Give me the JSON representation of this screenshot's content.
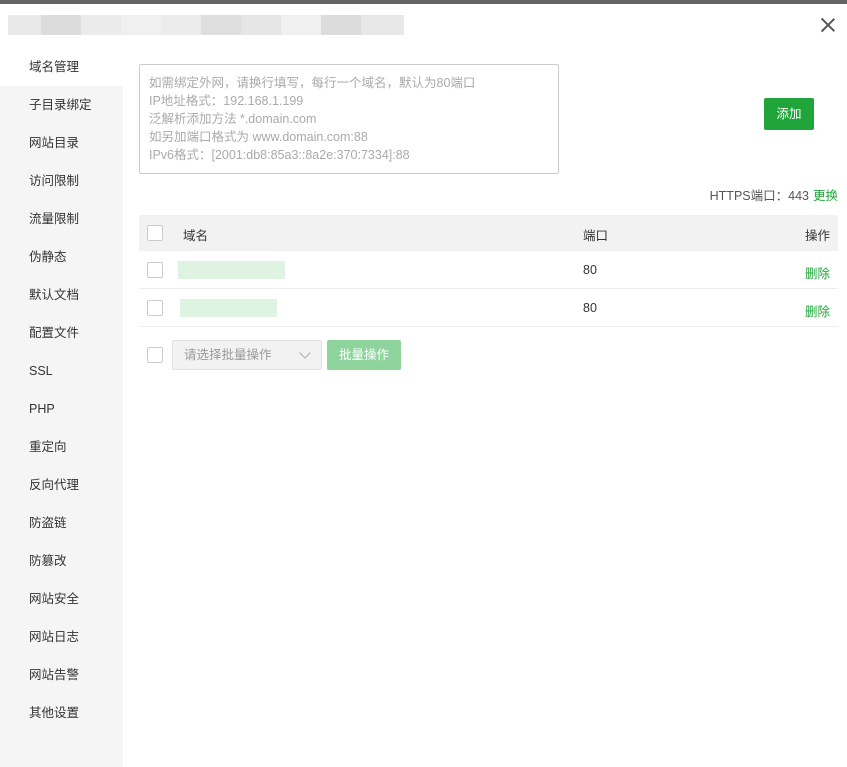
{
  "sidebar": {
    "items": [
      {
        "label": "域名管理"
      },
      {
        "label": "子目录绑定"
      },
      {
        "label": "网站目录"
      },
      {
        "label": "访问限制"
      },
      {
        "label": "流量限制"
      },
      {
        "label": "伪静态"
      },
      {
        "label": "默认文档"
      },
      {
        "label": "配置文件"
      },
      {
        "label": "SSL"
      },
      {
        "label": "PHP"
      },
      {
        "label": "重定向"
      },
      {
        "label": "反向代理"
      },
      {
        "label": "防盗链"
      },
      {
        "label": "防篡改"
      },
      {
        "label": "网站安全"
      },
      {
        "label": "网站日志"
      },
      {
        "label": "网站告警"
      },
      {
        "label": "其他设置"
      }
    ],
    "active_index": 0
  },
  "domain_input": {
    "value": "",
    "placeholder_lines": [
      "如需绑定外网，请换行填写，每行一个域名，默认为80端口",
      "IP地址格式：192.168.1.199",
      "泛解析添加方法 *.domain.com",
      "如另加端口格式为 www.domain.com:88",
      "IPv6格式：[2001:db8:85a3::8a2e:370:7334]:88"
    ]
  },
  "add_button": {
    "label": "添加"
  },
  "https": {
    "text": "HTTPS端口：443",
    "change_label": "更换"
  },
  "table": {
    "headers": {
      "domain": "域名",
      "port": "端口",
      "action": "操作"
    },
    "rows": [
      {
        "port": "80",
        "action": "删除"
      },
      {
        "port": "80",
        "action": "删除"
      }
    ]
  },
  "batch": {
    "select_placeholder": "请选择批量操作",
    "button_label": "批量操作"
  },
  "colors": {
    "accent": "#20a53a",
    "accent_disabled": "#90d49d",
    "sidebar_bg": "#f5f5f5"
  }
}
